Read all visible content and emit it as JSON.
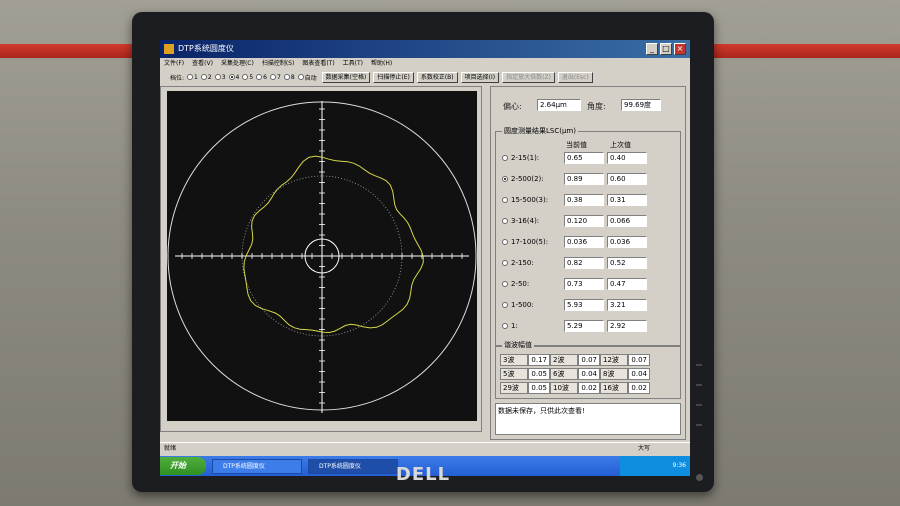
{
  "window": {
    "title": "DTP系统圆度仪"
  },
  "menu": [
    "文件(F)",
    "查看(V)",
    "采集处理(C)",
    "扫描控制(S)",
    "图表查看(T)",
    "工具(T)",
    "帮助(H)"
  ],
  "toolbar": {
    "prefix": "档位:",
    "radios": [
      "1",
      "2",
      "3",
      "4",
      "5",
      "6",
      "7",
      "8",
      "自动"
    ],
    "selected_radio": "4",
    "buttons": [
      "数据采集(空格)",
      "扫描停止(E)",
      "系数校正(B)",
      "项目选择(I)",
      "指定放大倍数(Z)",
      "退出(Esc)"
    ],
    "disabled": [
      "指定放大倍数(Z)",
      "退出(Esc)"
    ]
  },
  "eccentric": {
    "label": "偏心:",
    "value": "2.64μm",
    "angle_label": "角度:",
    "angle_value": "99.69度"
  },
  "results": {
    "title": "圆度测量结果LSC(μm)",
    "col_current": "当前值",
    "col_last": "上次值",
    "rows": [
      {
        "label": "2-15(1):",
        "current": "0.65",
        "last": "0.40",
        "selected": false
      },
      {
        "label": "2-500(2):",
        "current": "0.89",
        "last": "0.60",
        "selected": true
      },
      {
        "label": "15-500(3):",
        "current": "0.38",
        "last": "0.31",
        "selected": false
      },
      {
        "label": "3-16(4):",
        "current": "0.120",
        "last": "0.066",
        "selected": false
      },
      {
        "label": "17-100(5):",
        "current": "0.036",
        "last": "0.036",
        "selected": false
      },
      {
        "label": "2-150:",
        "current": "0.82",
        "last": "0.52",
        "selected": false
      },
      {
        "label": "2-50:",
        "current": "0.73",
        "last": "0.47",
        "selected": false
      },
      {
        "label": "1-500:",
        "current": "5.93",
        "last": "3.21",
        "selected": false
      },
      {
        "label": "1:",
        "current": "5.29",
        "last": "2.92",
        "selected": false
      }
    ]
  },
  "harmonics": {
    "title": "谐波幅值",
    "items": [
      {
        "label": "3波",
        "value": "0.17"
      },
      {
        "label": "2波",
        "value": "0.07"
      },
      {
        "label": "12波",
        "value": "0.07"
      },
      {
        "label": "5波",
        "value": "0.05"
      },
      {
        "label": "6波",
        "value": "0.04"
      },
      {
        "label": "8波",
        "value": "0.04"
      },
      {
        "label": "29波",
        "value": "0.05"
      },
      {
        "label": "10波",
        "value": "0.02"
      },
      {
        "label": "16波",
        "value": "0.02"
      }
    ]
  },
  "message": "数据未保存，只供此次查看!",
  "status": {
    "left": "就绪",
    "caps": "大写"
  },
  "taskbar": {
    "start": "开始",
    "tasks": [
      "DTP系统圆度仪",
      "DTP系统圆度仪"
    ],
    "clock": "9:36"
  },
  "brand": "DELL"
}
